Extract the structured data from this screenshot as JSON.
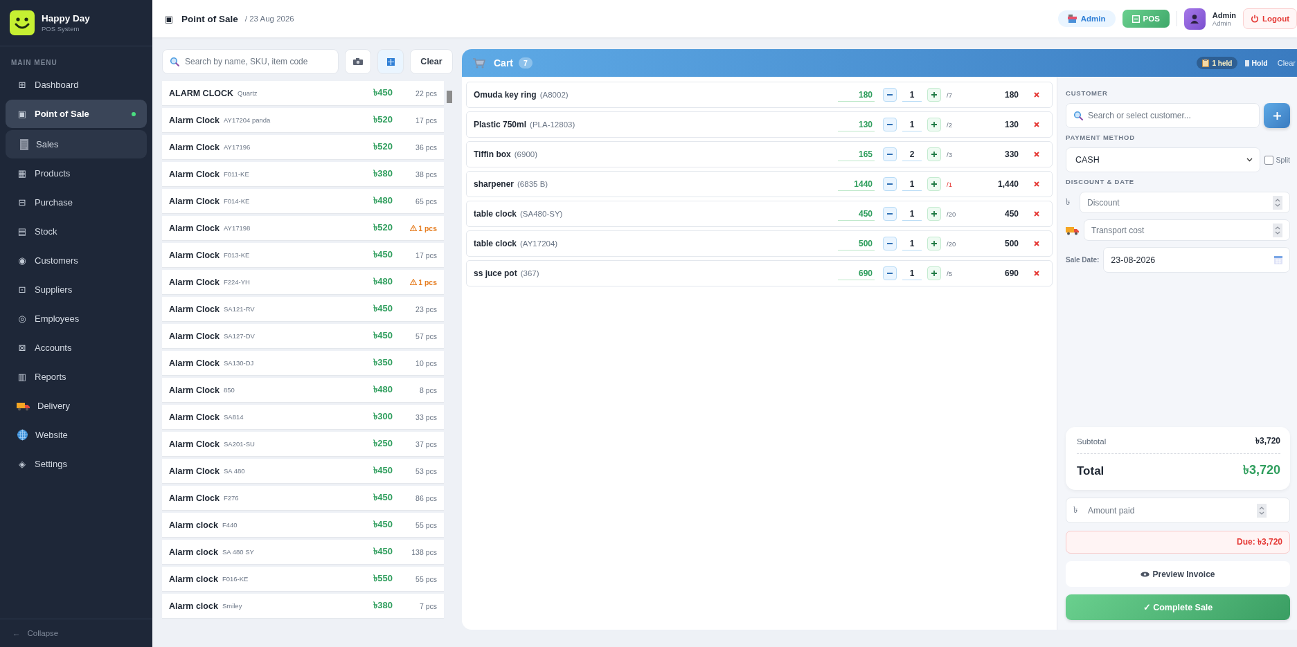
{
  "sidebar": {
    "brand": {
      "name": "Happy Day",
      "subtitle": "POS System"
    },
    "section": "MAIN MENU",
    "items": [
      {
        "kind": "glyph",
        "icon": "⊞",
        "label": "Dashboard",
        "selected": false
      },
      {
        "kind": "glyph",
        "icon": "▣",
        "label": "Point of Sale",
        "selected": true,
        "children": [
          {
            "kind": "receipt",
            "label": "Sales",
            "selected": false
          }
        ]
      },
      {
        "kind": "glyph",
        "icon": "▦",
        "label": "Products",
        "selected": false
      },
      {
        "kind": "glyph",
        "icon": "⊟",
        "label": "Purchase",
        "selected": false
      },
      {
        "kind": "glyph",
        "icon": "▤",
        "label": "Stock",
        "selected": false
      },
      {
        "kind": "glyph",
        "icon": "◉",
        "label": "Customers",
        "selected": false
      },
      {
        "kind": "glyph",
        "icon": "⊡",
        "label": "Suppliers",
        "selected": false
      },
      {
        "kind": "glyph",
        "icon": "◎",
        "label": "Employees",
        "selected": false
      },
      {
        "kind": "glyph",
        "icon": "⊠",
        "label": "Accounts",
        "selected": false
      },
      {
        "kind": "glyph",
        "icon": "▥",
        "label": "Reports",
        "selected": false
      },
      {
        "kind": "truck",
        "label": "Delivery",
        "selected": false
      },
      {
        "kind": "globe",
        "label": "Website",
        "selected": false
      },
      {
        "kind": "glyph",
        "icon": "◈",
        "label": "Settings",
        "selected": false
      }
    ],
    "collapse": {
      "icon": "←",
      "label": "Collapse"
    }
  },
  "header": {
    "icon": "▣",
    "title": "Point of Sale",
    "date": "/ 23 Aug 2026",
    "admin_pill": "Admin",
    "pos_button": "POS",
    "user": {
      "name": "Admin",
      "role": "Admin"
    },
    "logout": "Logout"
  },
  "products": {
    "search": {
      "placeholder": "Search by name, SKU, item code"
    },
    "clear": "Clear",
    "items": [
      {
        "name": "ALARM CLOCK",
        "code": "Quartz",
        "price": "৳450",
        "stock": "22 pcs",
        "low": false
      },
      {
        "name": "Alarm Clock",
        "code": "AY17204 panda",
        "price": "৳520",
        "stock": "17 pcs",
        "low": false
      },
      {
        "name": "Alarm Clock",
        "code": "AY17196",
        "price": "৳520",
        "stock": "36 pcs",
        "low": false
      },
      {
        "name": "Alarm Clock",
        "code": "F011-KE",
        "price": "৳380",
        "stock": "38 pcs",
        "low": false
      },
      {
        "name": "Alarm Clock",
        "code": "F014-KE",
        "price": "৳480",
        "stock": "65 pcs",
        "low": false
      },
      {
        "name": "Alarm Clock",
        "code": "AY17198",
        "price": "৳520",
        "stock": "1 pcs",
        "low": true
      },
      {
        "name": "Alarm Clock",
        "code": "F013-KE",
        "price": "৳450",
        "stock": "17 pcs",
        "low": false
      },
      {
        "name": "Alarm Clock",
        "code": "F224-YH",
        "price": "৳480",
        "stock": "1 pcs",
        "low": true
      },
      {
        "name": "Alarm Clock",
        "code": "SA121-RV",
        "price": "৳450",
        "stock": "23 pcs",
        "low": false
      },
      {
        "name": "Alarm Clock",
        "code": "SA127-DV",
        "price": "৳450",
        "stock": "57 pcs",
        "low": false
      },
      {
        "name": "Alarm Clock",
        "code": "SA130-DJ",
        "price": "৳350",
        "stock": "10 pcs",
        "low": false
      },
      {
        "name": "Alarm Clock",
        "code": "850",
        "price": "৳480",
        "stock": "8 pcs",
        "low": false
      },
      {
        "name": "Alarm Clock",
        "code": "SA814",
        "price": "৳300",
        "stock": "33 pcs",
        "low": false
      },
      {
        "name": "Alarm Clock",
        "code": "SA201-SU",
        "price": "৳250",
        "stock": "37 pcs",
        "low": false
      },
      {
        "name": "Alarm Clock",
        "code": "SA 480",
        "price": "৳450",
        "stock": "53 pcs",
        "low": false
      },
      {
        "name": "Alarm Clock",
        "code": "F276",
        "price": "৳450",
        "stock": "86 pcs",
        "low": false
      },
      {
        "name": "Alarm clock",
        "code": "F440",
        "price": "৳450",
        "stock": "55 pcs",
        "low": false
      },
      {
        "name": "Alarm clock",
        "code": "SA 480 SY",
        "price": "৳450",
        "stock": "138 pcs",
        "low": false
      },
      {
        "name": "Alarm clock",
        "code": "F016-KE",
        "price": "৳550",
        "stock": "55 pcs",
        "low": false
      },
      {
        "name": "Alarm clock",
        "code": "Smiley",
        "price": "৳380",
        "stock": "7 pcs",
        "low": false
      }
    ]
  },
  "cart": {
    "title": "Cart",
    "count": "7",
    "held": "1 held",
    "hold": "Hold",
    "clear": "Clear",
    "items": [
      {
        "name": "Omuda key ring",
        "code": "(A8002)",
        "price": "180",
        "qty": "1",
        "stock": "/7",
        "stock_low": false,
        "total": "180"
      },
      {
        "name": "Plastic 750ml",
        "code": "(PLA-12803)",
        "price": "130",
        "qty": "1",
        "stock": "/2",
        "stock_low": false,
        "total": "130"
      },
      {
        "name": "Tiffin box",
        "code": "(6900)",
        "price": "165",
        "qty": "2",
        "stock": "/3",
        "stock_low": false,
        "total": "330"
      },
      {
        "name": "sharpener",
        "code": "(6835 B)",
        "price": "1440",
        "qty": "1",
        "stock": "/1",
        "stock_low": true,
        "total": "1,440"
      },
      {
        "name": "table clock",
        "code": "(SA480-SY)",
        "price": "450",
        "qty": "1",
        "stock": "/20",
        "stock_low": false,
        "total": "450"
      },
      {
        "name": "table clock",
        "code": "(AY17204)",
        "price": "500",
        "qty": "1",
        "stock": "/20",
        "stock_low": false,
        "total": "500"
      },
      {
        "name": "ss juce pot",
        "code": "(367)",
        "price": "690",
        "qty": "1",
        "stock": "/5",
        "stock_low": false,
        "total": "690"
      }
    ]
  },
  "checkout": {
    "customer_label": "CUSTOMER",
    "customer_search": {
      "placeholder": "Search or select customer..."
    },
    "payment_label": "PAYMENT METHOD",
    "payment_method": "CASH",
    "split": {
      "label": "Split",
      "checked": false
    },
    "discount_label": "DISCOUNT & DATE",
    "currency": "৳",
    "discount": {
      "placeholder": "Discount"
    },
    "transport": {
      "placeholder": "Transport cost"
    },
    "sale_date_label": "Sale Date:",
    "sale_date": "23-08-2026",
    "subtotal_label": "Subtotal",
    "subtotal": "৳3,720",
    "total_label": "Total",
    "total": "৳3,720",
    "amount_paid": {
      "placeholder": "Amount paid"
    },
    "due": "Due: ৳3,720",
    "preview": "Preview Invoice",
    "complete": "✓ Complete Sale"
  }
}
